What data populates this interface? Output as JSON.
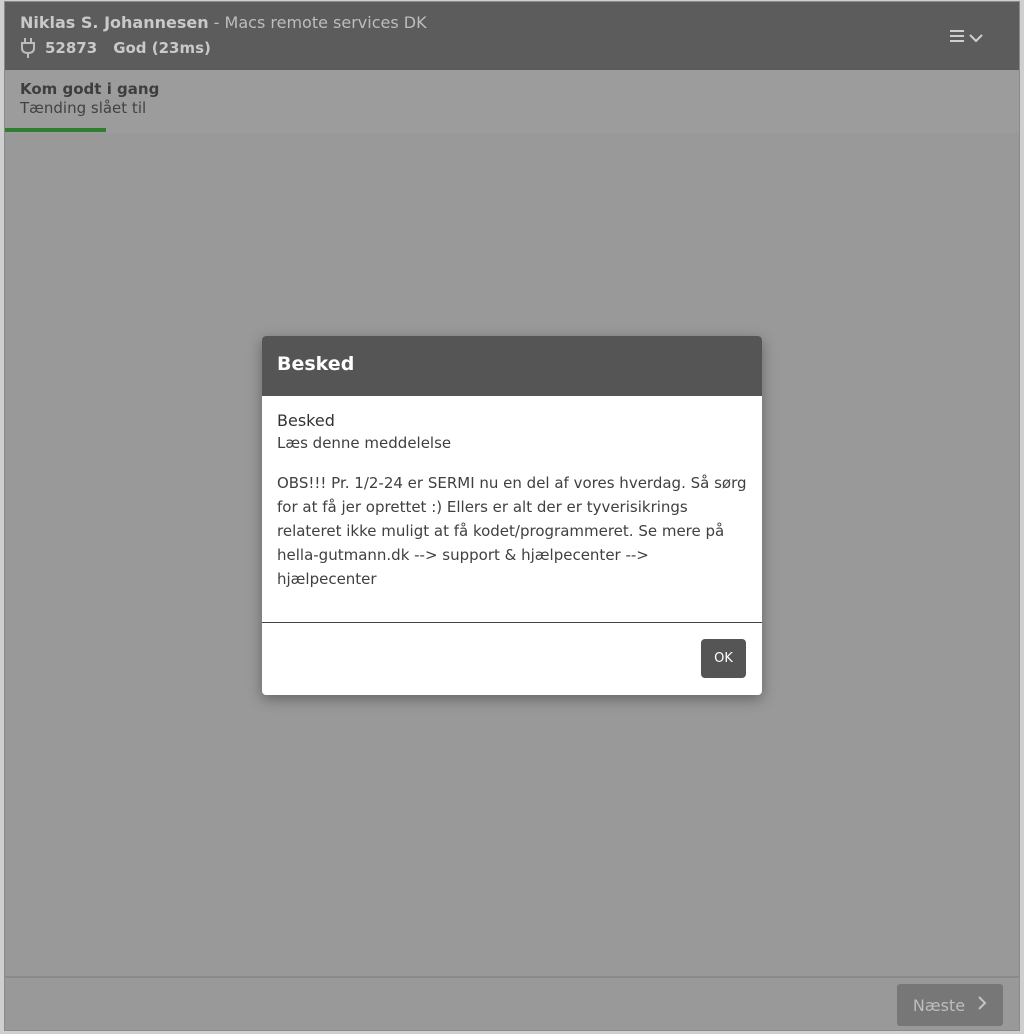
{
  "header": {
    "user_name": "Niklas S. Johannesen",
    "separator": " - ",
    "company": "Macs remote services DK",
    "device_id": "52873",
    "connection_status": "God (23ms)"
  },
  "step": {
    "title": "Kom godt i gang",
    "subtitle": "Tænding slået til",
    "progress_fraction": 0.1
  },
  "footer": {
    "next_label": "Næste"
  },
  "dialog": {
    "header": "Besked",
    "title": "Besked",
    "subtitle": "Læs denne meddelelse",
    "message": "OBS!!! Pr. 1/2-24 er SERMI nu en del af vores hverdag. Så sørg for at få jer oprettet :) Ellers er alt der er tyverisikrings relateret ikke muligt at få kodet/programmeret. Se mere på hella-gutmann.dk --> support & hjælpecenter --> hjælpecenter",
    "ok_label": "OK"
  },
  "colors": {
    "header_bg": "#5c5c5c",
    "progress": "#2f7d2f",
    "overlay": "#999999",
    "dialog_header": "#555555"
  },
  "icons": {
    "connection": "plug-icon",
    "menu": "hamburger-icon",
    "menu_toggle": "chevron-down-icon",
    "next": "chevron-right-icon"
  }
}
